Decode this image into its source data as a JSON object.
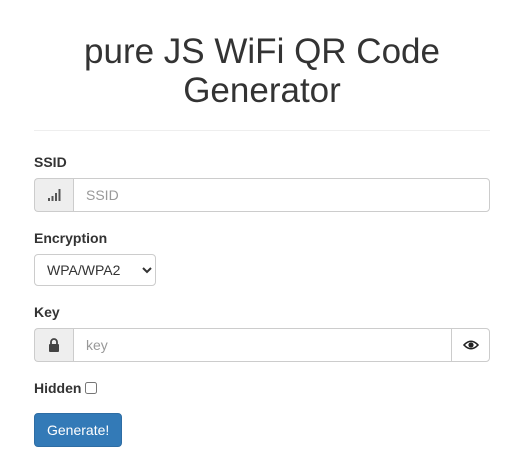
{
  "header": {
    "title_line1": "pure JS WiFi QR Code",
    "title_line2": "Generator"
  },
  "form": {
    "ssid": {
      "label": "SSID",
      "placeholder": "SSID",
      "value": "",
      "icon": "signal-icon"
    },
    "encryption": {
      "label": "Encryption",
      "selected": "WPA/WPA2"
    },
    "key": {
      "label": "Key",
      "placeholder": "key",
      "value": "",
      "icon": "lock-icon",
      "toggle_icon": "eye-icon"
    },
    "hidden": {
      "label": "Hidden",
      "checked": false
    },
    "generate_label": "Generate!"
  },
  "colors": {
    "primary": "#337ab7",
    "addon_bg": "#eeeeee",
    "border": "#cccccc"
  }
}
